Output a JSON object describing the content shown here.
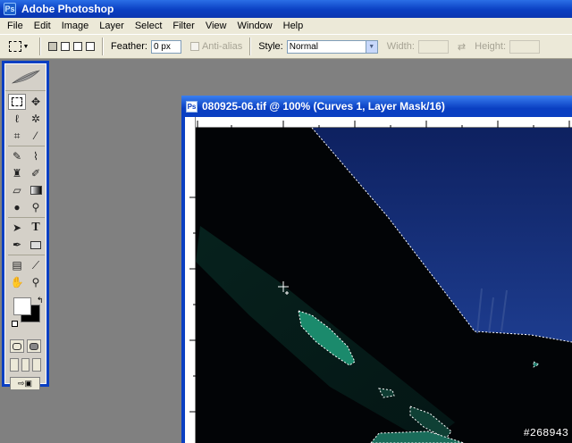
{
  "app": {
    "title": "Adobe Photoshop",
    "icon": "photoshop-icon"
  },
  "menu": [
    "File",
    "Edit",
    "Image",
    "Layer",
    "Select",
    "Filter",
    "View",
    "Window",
    "Help"
  ],
  "options": {
    "feather_label": "Feather:",
    "feather_value": "0 px",
    "antialias_label": "Anti-alias",
    "style_label": "Style:",
    "style_value": "Normal",
    "width_label": "Width:",
    "height_label": "Height:"
  },
  "document": {
    "title": "080925-06.tif @ 100% (Curves 1, Layer Mask/16)"
  },
  "colors": {
    "foreground": "#ffffff",
    "background": "#000000",
    "accent": "#0a3fc2"
  },
  "watermark": "#268943"
}
